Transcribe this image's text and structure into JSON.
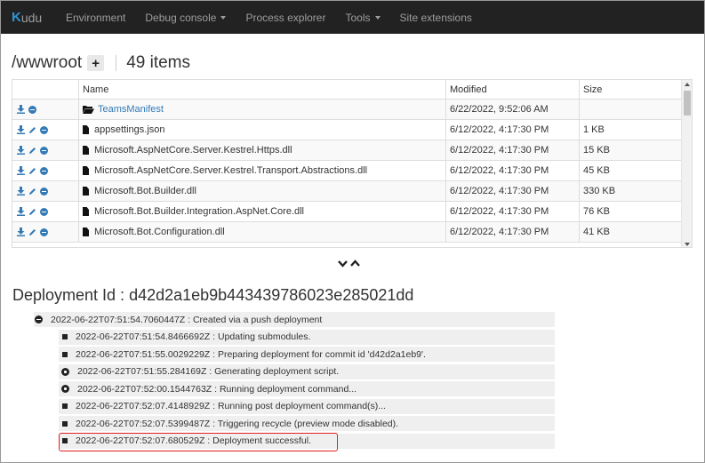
{
  "navbar": {
    "brand_k": "K",
    "brand_rest": "udu",
    "items": [
      {
        "label": "Environment",
        "has_caret": false
      },
      {
        "label": "Debug console",
        "has_caret": true
      },
      {
        "label": "Process explorer",
        "has_caret": false
      },
      {
        "label": "Tools",
        "has_caret": true
      },
      {
        "label": "Site extensions",
        "has_caret": false
      }
    ]
  },
  "browser": {
    "path": "/wwwroot",
    "add_label": "+",
    "item_count": "49 items",
    "columns": {
      "name": "Name",
      "modified": "Modified",
      "size": "Size"
    },
    "rows": [
      {
        "name": "TeamsManifest",
        "type": "folder",
        "modified": "6/22/2022, 9:52:06 AM",
        "size": ""
      },
      {
        "name": "appsettings.json",
        "type": "file",
        "modified": "6/12/2022, 4:17:30 PM",
        "size": "1 KB"
      },
      {
        "name": "Microsoft.AspNetCore.Server.Kestrel.Https.dll",
        "type": "file",
        "modified": "6/12/2022, 4:17:30 PM",
        "size": "15 KB"
      },
      {
        "name": "Microsoft.AspNetCore.Server.Kestrel.Transport.Abstractions.dll",
        "type": "file",
        "modified": "6/12/2022, 4:17:30 PM",
        "size": "45 KB"
      },
      {
        "name": "Microsoft.Bot.Builder.dll",
        "type": "file",
        "modified": "6/12/2022, 4:17:30 PM",
        "size": "330 KB"
      },
      {
        "name": "Microsoft.Bot.Builder.Integration.AspNet.Core.dll",
        "type": "file",
        "modified": "6/12/2022, 4:17:30 PM",
        "size": "76 KB"
      },
      {
        "name": "Microsoft.Bot.Configuration.dll",
        "type": "file",
        "modified": "6/12/2022, 4:17:30 PM",
        "size": "41 KB"
      }
    ]
  },
  "deployment": {
    "title": "Deployment Id : d42d2a1eb9b443439786023e285021dd",
    "log": [
      {
        "text": "2022-06-22T07:51:54.7060447Z : Created via a push deployment",
        "level": 1,
        "bullet": "minus"
      },
      {
        "text": "2022-06-22T07:51:54.8466692Z : Updating submodules.",
        "level": 2,
        "bullet": "square"
      },
      {
        "text": "2022-06-22T07:51:55.0029229Z : Preparing deployment for commit id 'd42d2a1eb9'.",
        "level": 2,
        "bullet": "square"
      },
      {
        "text": "2022-06-22T07:51:55.284169Z : Generating deployment script.",
        "level": 2,
        "bullet": "plus"
      },
      {
        "text": "2022-06-22T07:52:00.1544763Z : Running deployment command...",
        "level": 2,
        "bullet": "plus"
      },
      {
        "text": "2022-06-22T07:52:07.4148929Z : Running post deployment command(s)...",
        "level": 2,
        "bullet": "square"
      },
      {
        "text": "2022-06-22T07:52:07.5399487Z : Triggering recycle (preview mode disabled).",
        "level": 2,
        "bullet": "square"
      },
      {
        "text": "2022-06-22T07:52:07.680529Z : Deployment successful.",
        "level": 2,
        "bullet": "square"
      }
    ]
  },
  "colors": {
    "accent": "#337ab7",
    "navbar": "#222222",
    "highlight": "#e02020"
  }
}
